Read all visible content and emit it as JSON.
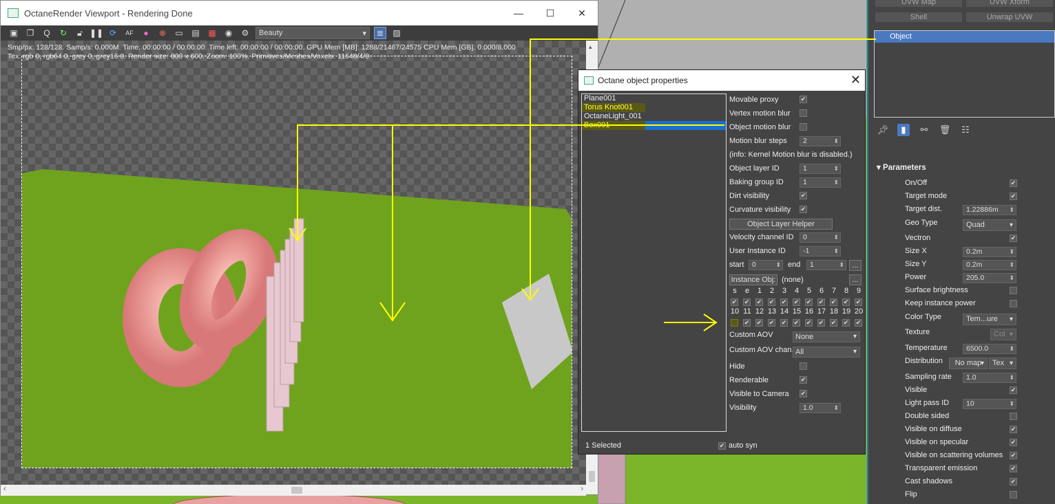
{
  "viewport": {
    "title": "OctaneRender Viewport - Rendering Done",
    "minimize": "—",
    "maximize": "☐",
    "close": "✕",
    "aov_select": "Beauty",
    "stats_line1": "Smp/px: 128/128.   Samp/s: 0.000M.   Time: 00:00:00 / 00:00:00.   Time left: 00:00:00 / 00:00:00.   GPU Mem [MB]: 1288/21467/24575   CPU Mem [GB]: 0.000/8.000",
    "stats_line2": "Tex: rgb 0, rgb64 0, grey 0, grey16 0.   Render size: 800 x 600.   Zoom: 100%.   Primitives/Meshes/Voxels: 11648/4/0",
    "toolbar_icons": [
      "save-icon",
      "copy-icon",
      "zoom-icon",
      "restart-icon",
      "lock-icon",
      "pause-icon",
      "refresh-icon",
      "afr-icon",
      "color-picker-icon",
      "stop-icon",
      "display-icon",
      "film-icon",
      "render-region-icon",
      "camera-icon",
      "settings-icon"
    ]
  },
  "object_props": {
    "title": "Octane object properties",
    "close": "✕",
    "objects": [
      {
        "name": "Plane001",
        "highlighted": false
      },
      {
        "name": "Torus Knot001",
        "highlighted": true
      },
      {
        "name": "OctaneLight_001",
        "highlighted": false
      },
      {
        "name": "Box001",
        "highlighted": true
      }
    ],
    "movable_proxy": "Movable proxy",
    "vertex_motion_blur": "Vertex motion blur",
    "object_motion_blur": "Object motion blur",
    "motion_blur_steps": "Motion blur steps",
    "motion_blur_steps_value": "2",
    "info_kernel": "(info: Kernel Motion blur is disabled.)",
    "object_layer_id": "Object layer ID",
    "object_layer_id_value": "1",
    "baking_group_id": "Baking group ID",
    "baking_group_id_value": "1",
    "dirt_visibility": "Dirt visibility",
    "curvature_visibility": "Curvature visibility",
    "object_layer_helper": "Object Layer Helper",
    "velocity_channel_id": "Velocity channel ID",
    "velocity_channel_id_value": "0",
    "user_instance_id": "User Instance ID",
    "user_instance_id_value": "-1",
    "start_label": "start",
    "start_value": "0",
    "end_label": "end",
    "end_value": "1",
    "ellipsis": "...",
    "instance_obj": "Instance Obj:",
    "instance_obj_value": "(none)",
    "grid_row1": [
      "s",
      "e",
      "1",
      "2",
      "3",
      "4",
      "5",
      "6",
      "7",
      "8",
      "9"
    ],
    "grid_row2": [
      "10",
      "11",
      "12",
      "13",
      "14",
      "15",
      "16",
      "17",
      "18",
      "19",
      "20"
    ],
    "custom_aov": "Custom AOV",
    "custom_aov_value": "None",
    "custom_aov_chan": "Custom AOV chan.",
    "custom_aov_chan_value": "All",
    "hide": "Hide",
    "renderable": "Renderable",
    "visible_to_camera": "Visible to Camera",
    "visibility": "Visibility",
    "visibility_value": "1.0",
    "status": "1 Selected",
    "auto_sync": "auto syn"
  },
  "command_panel": {
    "uvw_map": "UVW Map",
    "uvw_xform": "UVW Xform",
    "shell": "Shell",
    "unwrap_uvw": "Unwrap UVW",
    "modifier_selected": "Object",
    "parameters_header": "Parameters",
    "params": {
      "on_off": "On/Off",
      "target_mode": "Target mode",
      "target_dist": "Target dist.",
      "target_dist_value": "1.22886m",
      "geo_type": "Geo Type",
      "geo_type_value": "Quad",
      "vectron": "Vectron",
      "size_x": "Size X",
      "size_x_value": "0.2m",
      "size_y": "Size Y",
      "size_y_value": "0.2m",
      "power": "Power",
      "power_value": "205.0",
      "surface_brightness": "Surface brightness",
      "keep_instance_power": "Keep instance power",
      "color_type": "Color Type",
      "color_type_value": "Tem...ure",
      "texture": "Texture",
      "texture_value": "Col",
      "temperature": "Temperature",
      "temperature_value": "6500.0",
      "distribution": "Distribution",
      "distribution_map": "No map",
      "distribution_tex": "Tex",
      "sampling_rate": "Sampling rate",
      "sampling_rate_value": "1.0",
      "visible": "Visible",
      "light_pass_id": "Light pass ID",
      "light_pass_id_value": "10",
      "double_sided": "Double sided",
      "visible_on_diffuse": "Visible on diffuse",
      "visible_on_specular": "Visible on specular",
      "visible_on_scattering": "Visible on scattering volumes",
      "transparent_emission": "Transparent emission",
      "cast_shadows": "Cast shadows",
      "flip": "Flip"
    }
  },
  "colors": {
    "accent_blue": "#4a79c0",
    "highlight_yellow": "#ffff30",
    "annotation_arrow": "#ffff00",
    "floor_green": "#6fa31e"
  }
}
